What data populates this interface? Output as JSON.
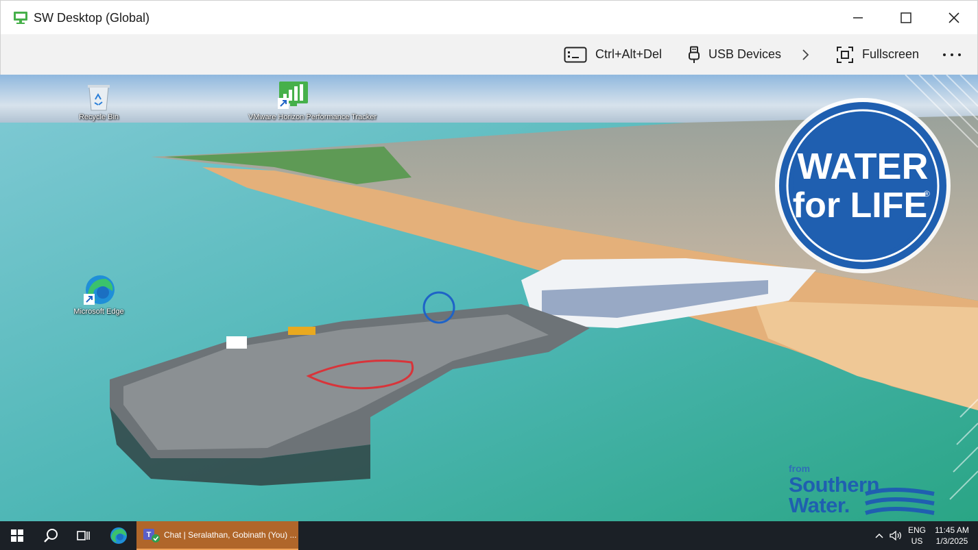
{
  "window": {
    "title": "SW Desktop (Global)",
    "controls": [
      "minimize",
      "maximize",
      "close"
    ]
  },
  "toolbar": {
    "ctrl_alt_del_label": "Ctrl+Alt+Del",
    "usb_label": "USB Devices",
    "fullscreen_label": "Fullscreen",
    "more_icon": "ellipsis-icon",
    "chevron_icon": "chevron-right-icon"
  },
  "desktop": {
    "icons": [
      {
        "label": "Recycle Bin",
        "icon": "recycle-bin-icon"
      },
      {
        "label": "VMware Horizon Performance Tracker",
        "icon": "performance-tracker-icon"
      },
      {
        "label": "Microsoft Edge",
        "icon": "edge-icon"
      }
    ],
    "wallpaper": {
      "badge_line1": "WATER",
      "badge_line2": "for LIFE",
      "badge_mark": "®",
      "brand_from": "from",
      "brand_name_line1": "Southern",
      "brand_name_line2": "Water."
    }
  },
  "taskbar": {
    "chat_window_label": "Chat | Seralathan, Gobinath (You) ...",
    "language": "ENG",
    "region": "US",
    "time": "11:45 AM",
    "date": "1/3/2025"
  },
  "colors": {
    "brand_blue": "#1f5fb0",
    "taskbar": "#1b2026",
    "active_task": "#b0662a"
  }
}
